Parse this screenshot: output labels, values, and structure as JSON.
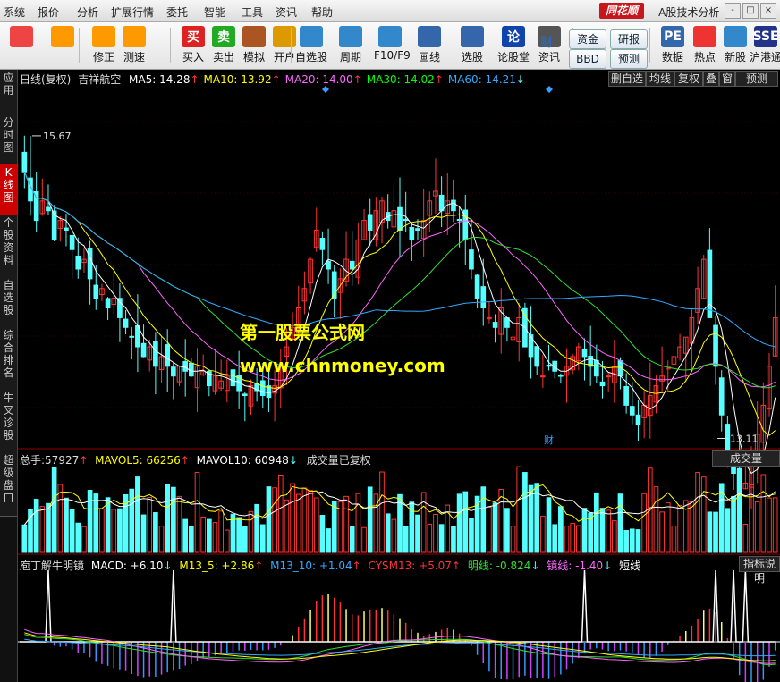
{
  "menu": [
    "系统",
    "报价",
    "分析",
    "扩展行情",
    "委托",
    "智能",
    "工具",
    "资讯",
    "帮助"
  ],
  "brand": "同花顺",
  "app_title": "- A股技术分析",
  "window_controls": [
    "-",
    "□",
    "×"
  ],
  "toolbar": {
    "buttons": [
      {
        "label": "",
        "icon": "windows-grid-icon"
      },
      {
        "label": "",
        "icon": "back-arrow-icon"
      },
      {
        "label": "修正",
        "icon": "up-down-icon"
      },
      {
        "label": "测速",
        "icon": "clock-icon"
      },
      {
        "label": "买入",
        "icon": "buy-icon",
        "glyph": "买"
      },
      {
        "label": "卖出",
        "icon": "sell-icon",
        "glyph": "卖"
      },
      {
        "label": "模拟",
        "icon": "gavel-icon"
      },
      {
        "label": "开户",
        "icon": "lock-icon"
      },
      {
        "label": "自选股",
        "icon": "star-icon"
      },
      {
        "label": "周期",
        "icon": "cycle-icon"
      },
      {
        "label": "F10/F9",
        "icon": "doc-icon"
      },
      {
        "label": "画线",
        "icon": "pen-icon"
      },
      {
        "label": "选股",
        "icon": "screen-icon"
      },
      {
        "label": "论股堂",
        "icon": "discuss-icon",
        "glyph": "论"
      },
      {
        "label": "资讯",
        "icon": "news-icon"
      },
      {
        "label": "数据",
        "icon": "pe-icon",
        "glyph": "PE"
      },
      {
        "label": "热点",
        "icon": "hot-icon"
      },
      {
        "label": "新股",
        "icon": "new-stock-icon"
      },
      {
        "label": "沪港通",
        "icon": "sse-hkex-icon",
        "glyph": "SSE"
      }
    ],
    "pills": [
      "资金",
      "研报",
      "BBD",
      "预测"
    ],
    "fin_glyph": "财"
  },
  "sidebar_tabs": [
    "应用",
    "分时图",
    "K线图",
    "个股资料",
    "自选股",
    "综合排名",
    "牛叉诊股",
    "超级盘口"
  ],
  "kline": {
    "header_prefix": "日线(复权)",
    "stock_name": "吉祥航空",
    "ma": [
      {
        "label": "MA5: 14.28",
        "arrow": "↑",
        "color": "#ffffff"
      },
      {
        "label": "MA10: 13.92",
        "arrow": "↑",
        "color": "#ffff00"
      },
      {
        "label": "MA20: 14.00",
        "arrow": "↑",
        "color": "#ff66ff"
      },
      {
        "label": "MA30: 14.02",
        "arrow": "↑",
        "color": "#00ff00"
      },
      {
        "label": "MA60: 14.21",
        "arrow": "↓",
        "color": "#33aaff"
      }
    ],
    "right_buttons": [
      "删自选",
      "均线",
      "复权",
      "叠",
      "窗",
      "预测"
    ],
    "high_label": "15.67",
    "low_label": "13.11",
    "fin_marker": "财"
  },
  "volume": {
    "prefix": "总手:",
    "total": "57927",
    "mavol5": "MAVOL5: 66256",
    "mavol10": "MAVOL10: 60948",
    "note": "成交量已复权",
    "right_label": "成交量"
  },
  "indicator": {
    "name": "庖丁解牛明镜",
    "macd": "MACD: +6.10",
    "m13_5": "M13_5: +2.86",
    "m13_10": "M13_10: +1.04",
    "cysm13": "CYSM13: +5.07",
    "ming": "明线: -0.824",
    "jing": "镜线: -1.40",
    "short": "短线",
    "right_label": "指标说明"
  },
  "watermark": {
    "line1": "第一股票公式网",
    "line2": "www.chnmoney.com"
  },
  "colors": {
    "up": "#ff3333",
    "down": "#55ffff",
    "ma5": "#ffffff",
    "ma10": "#ffff00",
    "ma20": "#ff66ff",
    "ma30": "#33dd33",
    "ma60": "#33aaff",
    "accent": "#c00000"
  },
  "kline_closes": [
    15.3,
    15.0,
    14.8,
    15.0,
    14.9,
    14.6,
    14.8,
    14.7,
    14.5,
    14.3,
    14.4,
    14.2,
    14.0,
    14.1,
    13.9,
    14.0,
    13.8,
    13.7,
    13.6,
    13.5,
    13.4,
    13.5,
    13.3,
    13.4,
    13.3,
    13.2,
    13.3,
    13.25,
    13.2,
    13.3,
    13.25,
    13.1,
    13.2,
    13.15,
    13.2,
    13.1,
    13.05,
    13.0,
    13.1,
    13.05,
    13.0,
    12.98,
    13.1,
    13.3,
    13.5,
    13.7,
    13.9,
    14.1,
    14.4,
    14.7,
    14.5,
    14.3,
    14.0,
    14.2,
    14.4,
    14.3,
    14.6,
    14.8,
    14.7,
    14.9,
    15.0,
    14.8,
    14.9,
    14.7,
    14.8,
    14.6,
    14.7,
    14.8,
    15.0,
    15.1,
    14.9,
    15.0,
    14.9,
    14.8,
    14.6,
    14.3,
    14.0,
    13.9,
    13.8,
    13.7,
    13.9,
    13.7,
    13.6,
    13.8,
    13.5,
    13.4,
    13.3,
    13.2,
    13.3,
    13.25,
    13.2,
    13.3,
    13.4,
    13.5,
    13.4,
    13.3,
    13.2,
    13.1,
    13.2,
    13.3,
    13.2,
    12.9,
    12.8,
    12.7,
    12.9,
    13.0,
    13.1,
    13.2,
    13.3,
    13.4,
    13.5,
    13.6,
    13.8,
    14.1,
    14.4,
    13.8,
    13.3,
    12.8,
    12.4,
    12.2,
    12.0,
    12.1,
    12.3,
    12.6,
    12.9,
    13.3,
    13.8
  ]
}
